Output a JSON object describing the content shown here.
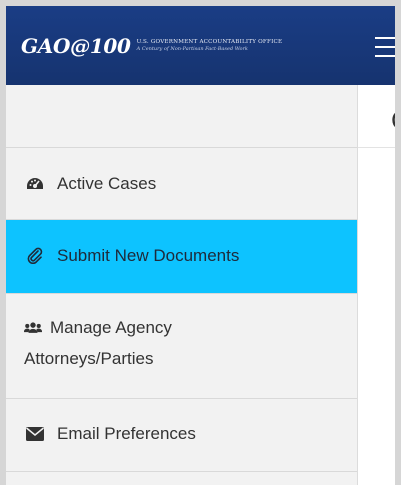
{
  "header": {
    "logo_main": "GAO@100",
    "logo_org": "U.S. GOVERNMENT ACCOUNTABILITY OFFICE",
    "logo_tagline": "A Century of Non-Partisan Fact-Based Work",
    "menu_icon": "hamburger-icon",
    "bg_color": "#16336f"
  },
  "sidebar": {
    "active_color": "#0dc3ff",
    "items": [
      {
        "label": "Active Cases",
        "icon": "dashboard-icon"
      },
      {
        "label": "Submit New Documents",
        "icon": "paperclip-icon",
        "active": true
      },
      {
        "label": "Manage Agency Attorneys/Parties",
        "icon": "users-icon"
      },
      {
        "label": "Email Preferences",
        "icon": "envelope-icon"
      }
    ]
  },
  "main": {
    "title_fragment": "C"
  }
}
